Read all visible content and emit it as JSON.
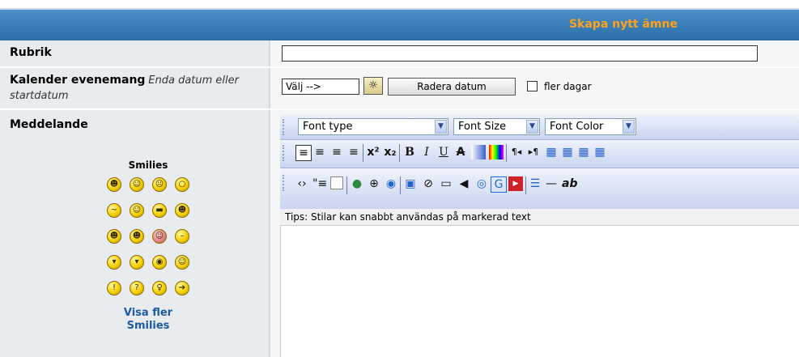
{
  "header": {
    "title": "Skapa nytt ämne"
  },
  "form": {
    "rubrik_label": "Rubrik",
    "kalender_label": "Kalender evenemang",
    "kalender_hint": "Enda datum eller startdatum",
    "date_value": "Välj -->",
    "clear_date_label": "Radera datum",
    "multi_days_label": "fler dagar",
    "meddelande_label": "Meddelande"
  },
  "toolbar": {
    "font_type": "Font type",
    "font_size": "Font Size",
    "font_color": "Font Color",
    "tips": "Tips: Stilar kan snabbt användas på markerad text"
  },
  "smilies": {
    "heading": "Smilies",
    "more_line1": "Visa fler",
    "more_line2": "Smilies",
    "rows": [
      [
        "grin",
        "smile",
        "sad",
        "surprised"
      ],
      [
        "confused",
        "cool",
        "shades",
        "laugh"
      ],
      [
        "razz",
        "mad",
        "embarrassed",
        "neutral"
      ],
      [
        "evil",
        "twisted",
        "rolleyes",
        "wink"
      ],
      [
        "exclaim",
        "question",
        "idea",
        "arrow"
      ]
    ]
  },
  "colors": {
    "header_accent": "#ffa21a",
    "header_bg": "#2c6ea8",
    "link": "#1e5aa0"
  }
}
